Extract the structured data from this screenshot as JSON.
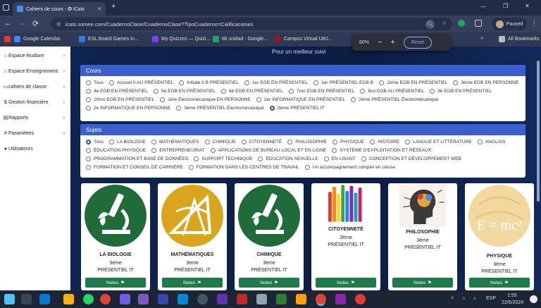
{
  "browser": {
    "tab_title": "Cahiers de cours - ✪ iCats",
    "new_tab": "+",
    "back": "←",
    "forward": "→",
    "reload": "⟳",
    "url": "icats.somee.com/CuadernoClase/CuadernoClase?TipoCuaderno=Calificaciones",
    "profile_status": "Paused",
    "window_min": "—",
    "window_max": "❐",
    "window_close": "✕"
  },
  "bookmarks": [
    {
      "label": "Google Calendar",
      "color": "#4285f4"
    },
    {
      "label": "ESL Board Games In...",
      "color": "#2c7be5"
    },
    {
      "label": "My Quizzes — Quizi...",
      "color": "#7b3ff2"
    },
    {
      "label": "Mi unidad - Google...",
      "color": "#1fa463"
    },
    {
      "label": "Campus Virtual UBJ...",
      "color": "#8b1d1d"
    }
  ],
  "all_bookmarks": "All Bookmarks",
  "zoom": {
    "level": "80%",
    "minus": "−",
    "plus": "+",
    "reset": "Reset"
  },
  "sidebar": {
    "items": [
      {
        "label": "Espace étudiant",
        "icon": "student-icon"
      },
      {
        "label": "Espace Enseignement",
        "icon": "teacher-icon"
      },
      {
        "label": "cahiers de classe",
        "icon": "notebook-icon"
      },
      {
        "label": "Gestion financière",
        "icon": "finance-icon"
      },
      {
        "label": "Rapports",
        "icon": "report-icon"
      },
      {
        "label": "Paramètres",
        "icon": "settings-icon"
      },
      {
        "label": "Utilisateurs",
        "icon": "users-icon"
      }
    ]
  },
  "main": {
    "subtitle": "Pour un meilleur suivi",
    "cours": {
      "title": "Cours",
      "options": [
        "Tous",
        "Accueil II AU PRÉSENTIEL",
        "Initiale II B PRÉSENTIEL",
        "1er EGB EN PRÉSENTIEL",
        "1er PRÉSENTIEL EGB B",
        "2ème EGB EN PRÉSENTIEL",
        "3ème EGB EN PERSONNE",
        "4è EGB EN PRÉSENTIEL",
        "5è EGB EN PRÉSENTIEL",
        "6è EGB EN PRÉSENTIEL",
        "7mo EGB EN PRÉSENTIEL",
        "8vo EGB AU PRÉSENTIEL",
        "9è EGB EN PRÉSENTIEL",
        "10mo EGB EN PRÉSENTIEL",
        "1ère Électromécanique EN PERSONNE",
        "1er INFORMATIQUE EN PRÉSENTIEL",
        "2ème PRÉSENTIEL Électromécanique",
        "2e INFORMATIQUE EN PERSONNE",
        "3ème PRÉSENTIEL Électromécanique",
        "3ème PRÉSENTIEL IT"
      ],
      "selected": 19
    },
    "sujets": {
      "title": "Sujets",
      "options": [
        "Tous",
        "LA BIOLOGIE",
        "MATHÉMATIQUES",
        "CHIMIQUE",
        "CITOYENNETÉ",
        "PHILOSOPHIE",
        "PHYSIQUE",
        "HISTOIRE",
        "LANGUE ET LITTÉRATURE",
        "ANGLAIS",
        "ÉDUCATION PHYSIQUE",
        "ENTREPRENEURIAT",
        "APPLICATIONS DE BUREAU LOCAL ET EN LIGNE",
        "SYSTÈME D'EXPLOITATION ET RÉSEAUX",
        "PROGRAMMATION ET BASE DE DONNÉES",
        "SUPPORT TECHNIQUE",
        "ÉDUCATION SEXUELLE",
        "EN LISANT",
        "CONCEPTION ET DÉVELOPPEMENT WEB",
        "FORMATION ET CONSEIL DE CARRIÈRE",
        "FORMATION DANS LES CENTRES DE TRAVAIL",
        "Un accompagnement complet en classe"
      ],
      "selected": 0
    },
    "cards": [
      {
        "title": "LA BIOLOGIE",
        "line1": "3eme",
        "line2": "PRÉSENTIEL IT",
        "button": "Notes",
        "image": "microscope-green"
      },
      {
        "title": "MATHÉMATIQUES",
        "line1": "3eme",
        "line2": "PRÉSENTIEL IT",
        "button": "Notes",
        "image": "geometry-yellow"
      },
      {
        "title": "CHIMIQUE",
        "line1": "3eme",
        "line2": "PRÉSENTIEL IT",
        "button": "Notes",
        "image": "microscope-green"
      },
      {
        "title": "CITOYENNETÉ",
        "line1": "3ème",
        "line2": "PRÉSENTIEL IT",
        "button": "Notes",
        "image": "raised-hands"
      },
      {
        "title": "PHILOSOPHIE",
        "line1": "3ème",
        "line2": "PRÉSENTIEL IT",
        "button": "Notes",
        "image": "thinker-head"
      },
      {
        "title": "PHYSIQUE",
        "line1": "3ème",
        "line2": "PRÉSENTIEL IT",
        "button": "Notes",
        "image": "emc2-yellow",
        "image_text": "E = mc²"
      }
    ]
  },
  "taskbar": {
    "lang": "ESP",
    "time": "1:55",
    "date": "22/6/2024"
  }
}
